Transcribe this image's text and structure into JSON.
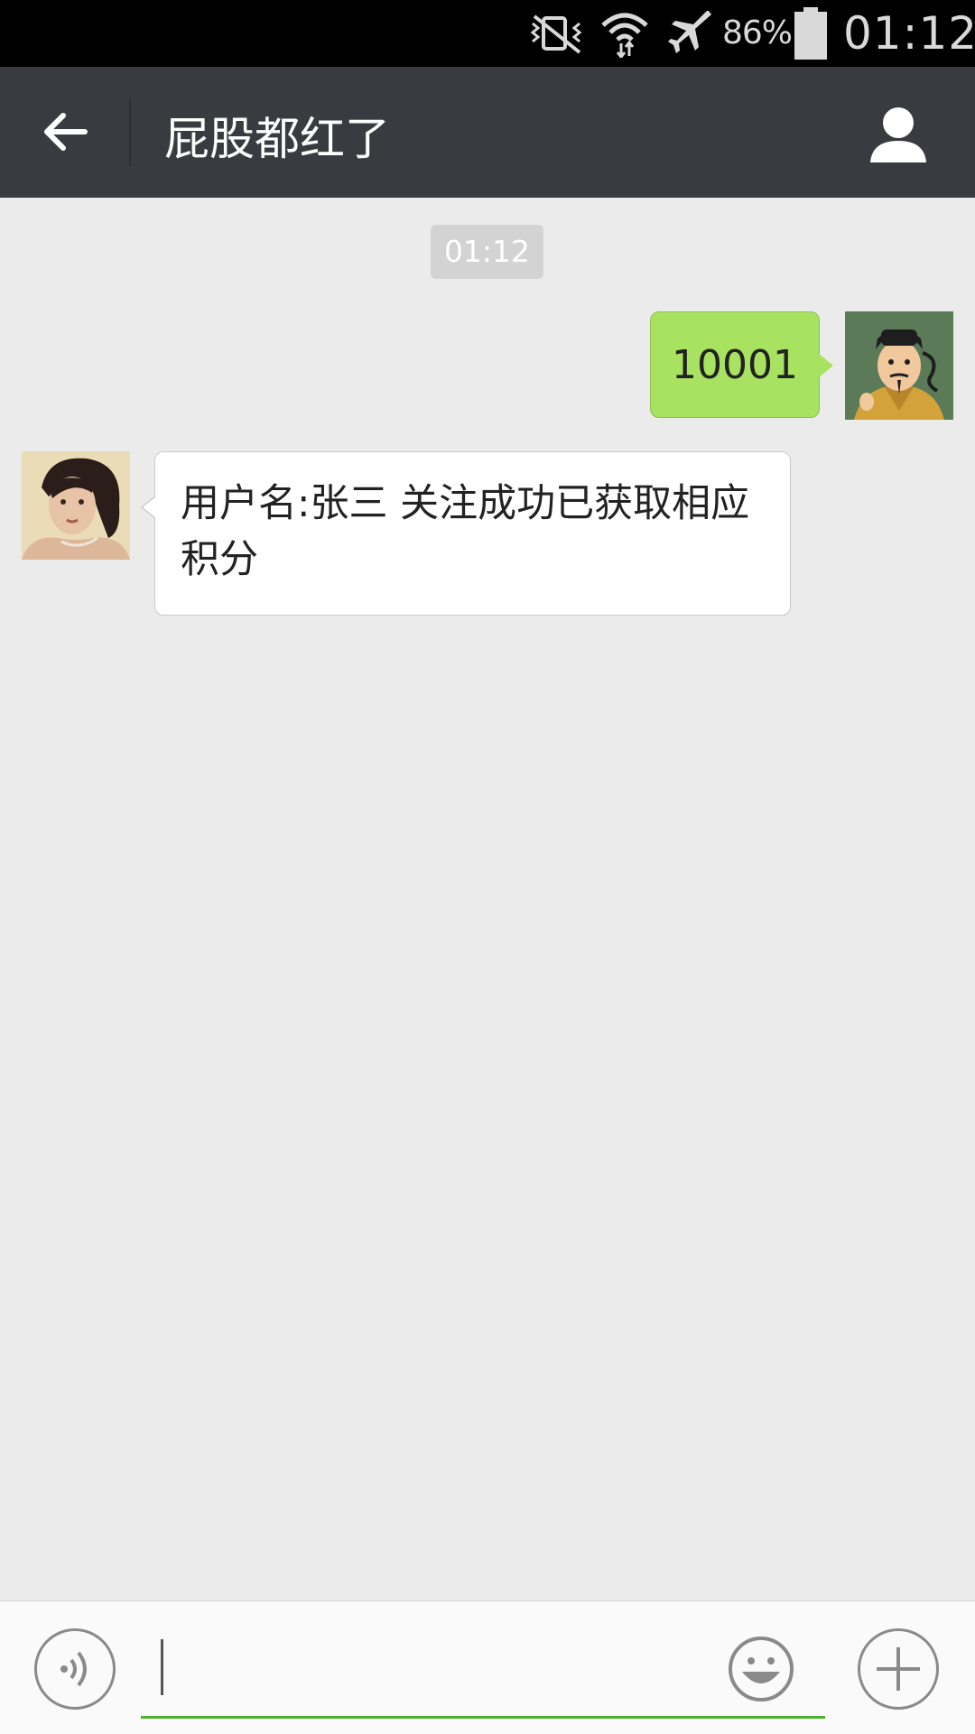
{
  "status_bar": {
    "battery_percent": "86%",
    "clock": "01:12",
    "icons": [
      "vibrate-mute-icon",
      "wifi-icon",
      "airplane-mode-icon",
      "battery-icon"
    ]
  },
  "header": {
    "title": "屁股都红了",
    "back_icon": "back-arrow-icon",
    "profile_icon": "contact-profile-icon"
  },
  "chat": {
    "timestamp": "01:12",
    "messages": [
      {
        "direction": "outgoing",
        "text": "10001"
      },
      {
        "direction": "incoming",
        "text": "用户名:张三 关注成功已获取相应积分"
      }
    ]
  },
  "input_bar": {
    "voice_icon": "voice-input-icon",
    "emoji_icon": "emoji-icon",
    "plus_icon": "more-plus-icon",
    "value": ""
  },
  "colors": {
    "header_bg": "#3a3b40",
    "chat_bg": "#ebebeb",
    "outgoing_bubble": "#a8e261",
    "input_underline": "#4ab527"
  }
}
